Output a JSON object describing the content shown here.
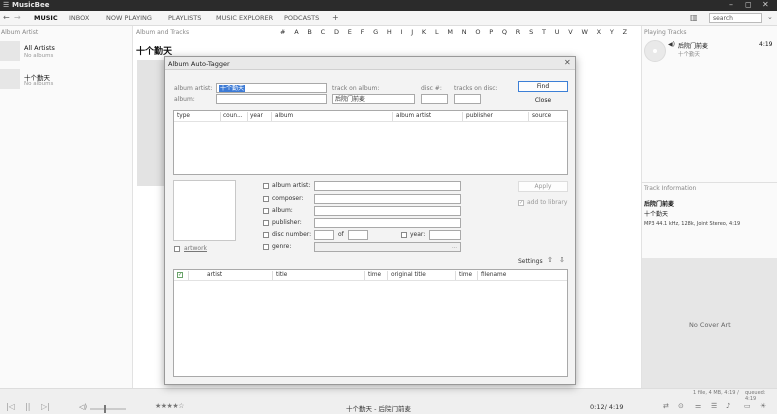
{
  "app": {
    "title": "MusicBee",
    "title_arrow": "⌄",
    "window_controls": [
      "–",
      "◻",
      "✕"
    ]
  },
  "tabs": [
    {
      "label": "MUSIC",
      "active": true
    },
    {
      "label": "INBOX"
    },
    {
      "label": "NOW PLAYING"
    },
    {
      "label": "PLAYLISTS"
    },
    {
      "label": "MUSIC EXPLORER"
    },
    {
      "label": "PODCASTS"
    },
    {
      "label": "+"
    }
  ],
  "nav": {
    "back": "←",
    "forward": "→",
    "layout_icon": "▥"
  },
  "search": {
    "placeholder": "search",
    "value": "search"
  },
  "left_panel": {
    "header": "Album Artist",
    "artists": [
      {
        "name": "All Artists",
        "sub": "No albums"
      },
      {
        "name": "十个勤天",
        "sub": "No albums"
      }
    ]
  },
  "center": {
    "header": "Album and Tracks",
    "artist_title": "十个勤天",
    "alphabet": "# A B C D E F G H I J K L M N O P Q R S T U V W X Y Z"
  },
  "right_panel": {
    "header": "Playing Tracks",
    "track": {
      "title": "后院门前麦",
      "artist": "十个勤天",
      "duration": "4:19"
    },
    "info_header": "Track Information",
    "info_title": "后院门前麦",
    "info_artist": "十个勤天",
    "info_details": "MP3 44.1 kHz, 128k, Joint Stereo, 4:19",
    "no_cover": "No Cover Art"
  },
  "status": {
    "summary": "1 file, 4 MB, 4:19 /",
    "queued": "queued: 4:19",
    "now_playing": "十个勤天 - 后院门前麦",
    "position": "0:12/ 4:19",
    "rating": "★★★★☆"
  },
  "dialog": {
    "title": "Album Auto-Tagger",
    "close": "✕",
    "search": {
      "album_artist_label": "album artist:",
      "album_artist_value": "十个勤天",
      "album_label": "album:",
      "album_value": "",
      "track_on_album_label": "track on album:",
      "track_on_album_value": "后院门前麦",
      "disc_label": "disc #:",
      "disc_value": "",
      "tracks_on_disc_label": "tracks on disc:",
      "tracks_on_disc_value": "",
      "find_label": "Find",
      "close_label": "Close"
    },
    "results_columns": [
      "type",
      "coun...",
      "year",
      "album",
      "album artist",
      "publisher",
      "source"
    ],
    "tags": {
      "artwork_label": "artwork",
      "album_artist_label": "album artist:",
      "composer_label": "composer:",
      "album_label": "album:",
      "publisher_label": "publisher:",
      "disc_number_label": "disc number:",
      "of_label": "of",
      "year_label": "year:",
      "genre_label": "genre:",
      "apply_label": "Apply",
      "add_to_library_label": "add to library",
      "settings_label": "Settings"
    },
    "tracks_columns": [
      "artist",
      "title",
      "time",
      "original title",
      "time",
      "filename"
    ]
  }
}
